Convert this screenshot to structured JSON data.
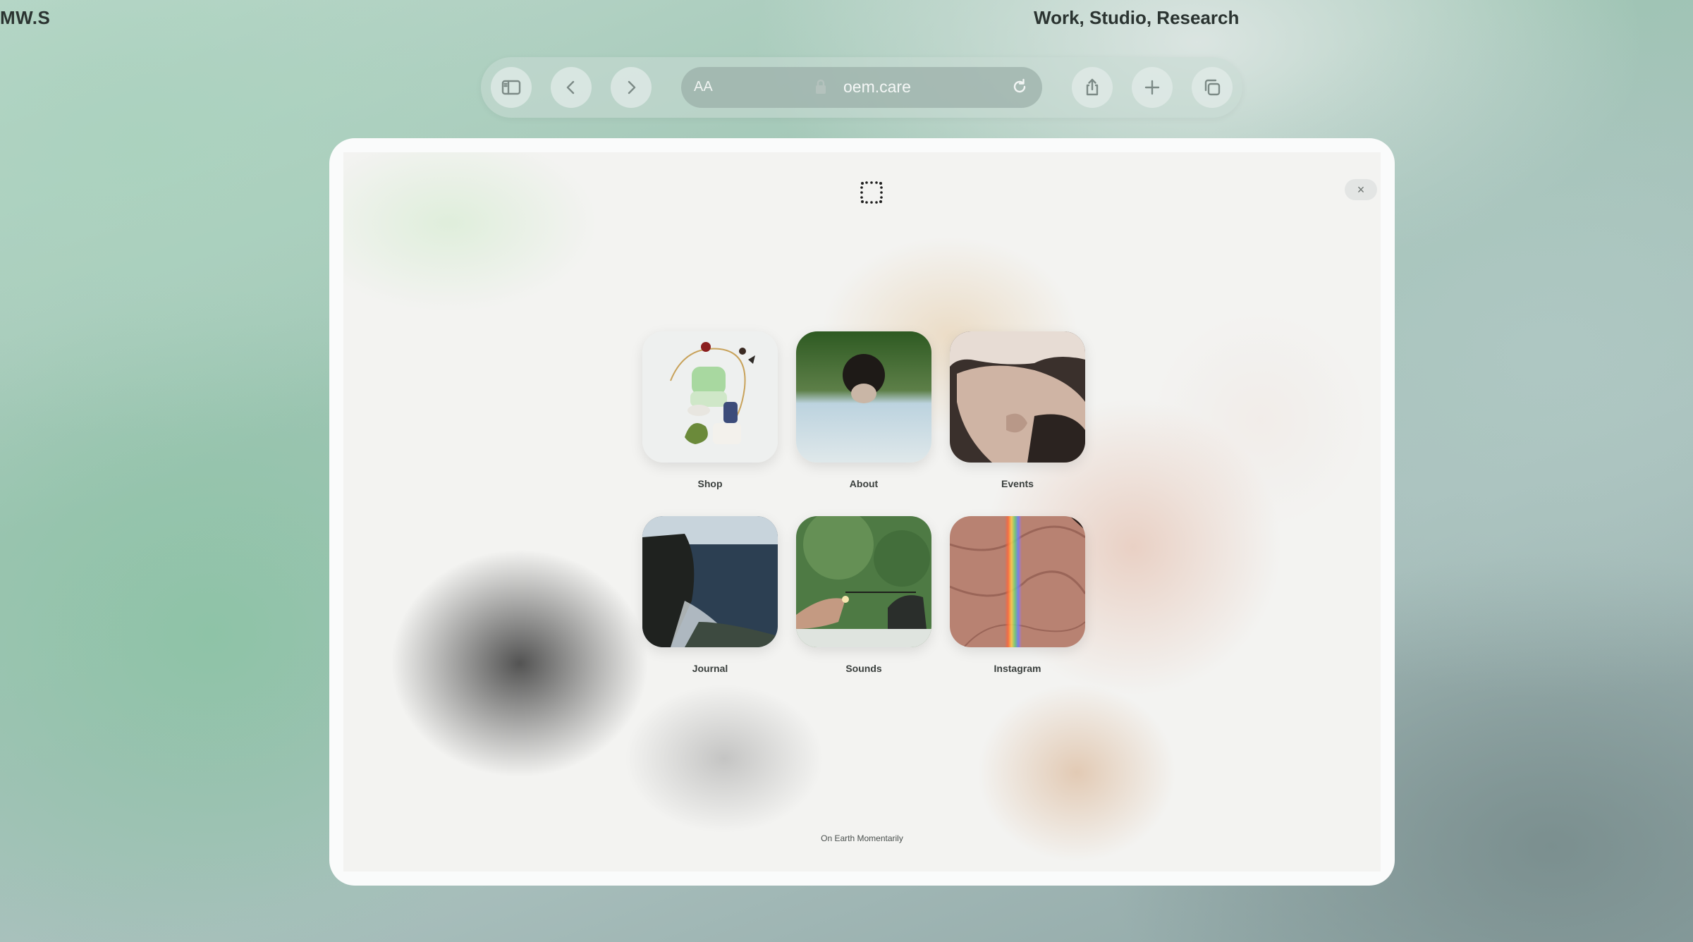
{
  "header": {
    "brand": "MW.S",
    "nav_text": "Work, Studio, Research"
  },
  "browser": {
    "text_size_label": "AA",
    "url": "oem.care",
    "buttons": [
      "sidebar-icon",
      "back-icon",
      "forward-icon",
      "share-icon",
      "plus-icon",
      "tabs-icon"
    ]
  },
  "modal": {
    "close_label": "×",
    "tiles": [
      {
        "label": "Shop"
      },
      {
        "label": "About"
      },
      {
        "label": "Events"
      },
      {
        "label": "Journal"
      },
      {
        "label": "Sounds"
      },
      {
        "label": "Instagram"
      }
    ],
    "footer": "On Earth Momentarily"
  },
  "colors": {
    "accent": "#2b3431",
    "toolbar_bg": "#c8dad4",
    "card_bg": "#fafbfb"
  }
}
